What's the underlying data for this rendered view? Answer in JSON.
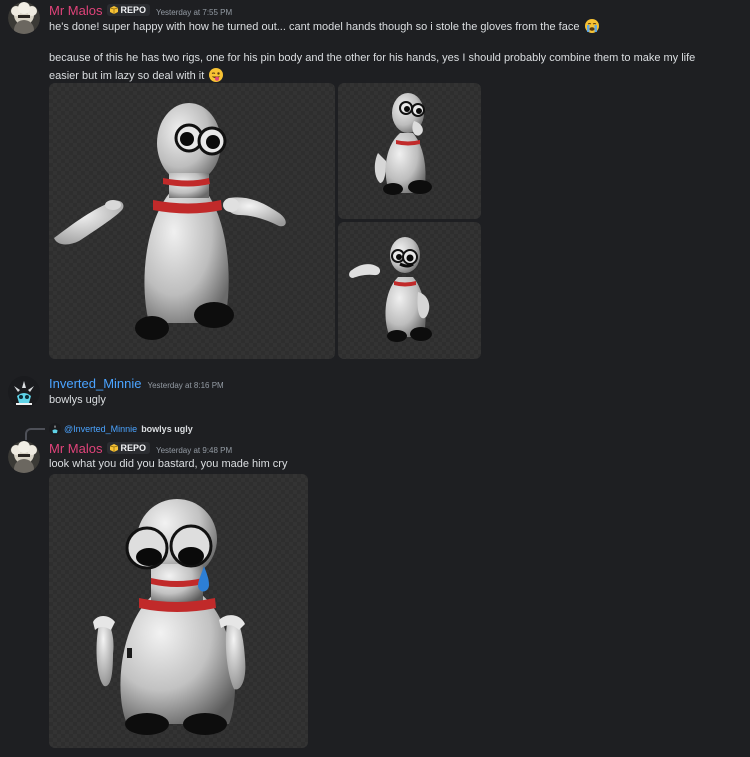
{
  "messages": [
    {
      "author": "Mr Malos",
      "tag": "REPO",
      "timestamp": "Yesterday at 7:55 PM",
      "line1": "he's done! super happy with how he turned out... cant model hands though so i stole the gloves from the face",
      "line2": "because of this he has two rigs, one for his pin body and the other for his hands, yes I should probably combine them to make my life",
      "line3": "easier but im lazy so deal with it",
      "emoji1": "crying-face-emoji",
      "emoji2": "winking-tongue-face-emoji",
      "attachments": [
        "bowling-pin-render-front",
        "bowling-pin-render-side",
        "bowling-pin-render-wave"
      ]
    },
    {
      "author": "Inverted_Minnie",
      "timestamp": "Yesterday at 8:16 PM",
      "text": "bowlys ugly"
    },
    {
      "reply_to_author": "@Inverted_Minnie",
      "reply_to_text": "bowlys ugly",
      "author": "Mr Malos",
      "tag": "REPO",
      "timestamp": "Yesterday at 9:48 PM",
      "text": "look what you did you bastard, you made him cry",
      "attachments": [
        "bowling-pin-render-crying"
      ]
    }
  ],
  "colors": {
    "background": "#1e1f22",
    "malos_name": "#e0437a",
    "minnie_name": "#4aa3ff",
    "timestamp": "#949ba4",
    "text": "#dbdee1"
  }
}
